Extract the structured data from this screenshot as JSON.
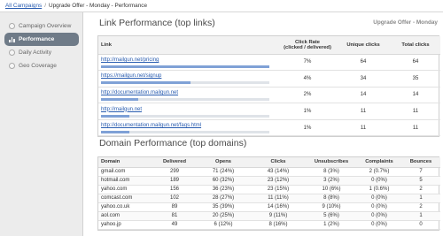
{
  "breadcrumb": {
    "root_link": "All Campaigns",
    "separator": "/",
    "current": "Upgrade Offer - Monday - Performance"
  },
  "sidebar": {
    "items": [
      {
        "label": "Campaign Overview",
        "icon": "circle-icon",
        "active": false
      },
      {
        "label": "Performance",
        "icon": "bar-chart-icon",
        "active": true
      },
      {
        "label": "Daily Activity",
        "icon": "circle-icon",
        "active": false
      },
      {
        "label": "Geo Coverage",
        "icon": "circle-icon",
        "active": false
      }
    ]
  },
  "link_performance": {
    "title": "Link Performance (top links)",
    "campaign_name": "Upgrade Offer - Monday",
    "headers": {
      "link": "Link",
      "click_rate": "Click Rate",
      "click_rate_sub": "(clicked / delivered)",
      "unique_clicks": "Unique clicks",
      "total_clicks": "Total clicks"
    },
    "rows": [
      {
        "url": "http://mailgun.net/pricing",
        "click_rate": "7%",
        "unique": "64",
        "total": "64",
        "share": 1.0
      },
      {
        "url": "https://mailgun.net/signup",
        "click_rate": "4%",
        "unique": "34",
        "total": "35",
        "share": 0.53
      },
      {
        "url": "http://documentation.mailgun.net",
        "click_rate": "2%",
        "unique": "14",
        "total": "14",
        "share": 0.22
      },
      {
        "url": "http://mailgun.net",
        "click_rate": "1%",
        "unique": "11",
        "total": "11",
        "share": 0.17
      },
      {
        "url": "http://documentation.mailgun.net/faqs.html",
        "click_rate": "1%",
        "unique": "11",
        "total": "11",
        "share": 0.17
      }
    ]
  },
  "domain_performance": {
    "title": "Domain Performance (top domains)",
    "headers": {
      "domain": "Domain",
      "delivered": "Delivered",
      "opens": "Opens",
      "clicks": "Clicks",
      "unsubscribes": "Unsubscribes",
      "complaints": "Complaints",
      "bounces": "Bounces"
    },
    "rows": [
      {
        "domain": "gmail.com",
        "delivered": "299",
        "opens": "71 (24%)",
        "clicks": "43 (14%)",
        "unsubscribes": "8 (3%)",
        "complaints": "2 (0.7%)",
        "bounces": "7"
      },
      {
        "domain": "hotmail.com",
        "delivered": "189",
        "opens": "60 (32%)",
        "clicks": "23 (12%)",
        "unsubscribes": "3 (2%)",
        "complaints": "0 (0%)",
        "bounces": "5"
      },
      {
        "domain": "yahoo.com",
        "delivered": "156",
        "opens": "36 (23%)",
        "clicks": "23 (15%)",
        "unsubscribes": "10 (6%)",
        "complaints": "1 (0.6%)",
        "bounces": "2"
      },
      {
        "domain": "comcast.com",
        "delivered": "102",
        "opens": "28 (27%)",
        "clicks": "11 (11%)",
        "unsubscribes": "8 (8%)",
        "complaints": "0 (0%)",
        "bounces": "1"
      },
      {
        "domain": "yahoo.co.uk",
        "delivered": "89",
        "opens": "35 (39%)",
        "clicks": "14 (16%)",
        "unsubscribes": "9 (10%)",
        "complaints": "0 (0%)",
        "bounces": "2"
      },
      {
        "domain": "aol.com",
        "delivered": "81",
        "opens": "20 (25%)",
        "clicks": "9 (11%)",
        "unsubscribes": "5 (6%)",
        "complaints": "0 (0%)",
        "bounces": "1"
      },
      {
        "domain": "yahoo.jp",
        "delivered": "49",
        "opens": "6 (12%)",
        "clicks": "8 (16%)",
        "unsubscribes": "1 (2%)",
        "complaints": "0 (0%)",
        "bounces": "0"
      }
    ]
  },
  "colors": {
    "accent_link": "#2a5db0",
    "active_nav": "#6f7b88",
    "bar_fill": "#7fa1d6",
    "bar_track": "#dfe3e8"
  }
}
